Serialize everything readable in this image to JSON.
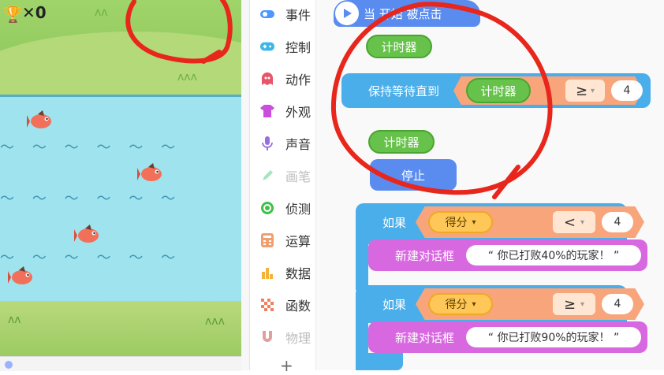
{
  "stage": {
    "score_symbol": "✕",
    "score_value": "0",
    "trophy_icon": "trophy-icon"
  },
  "sidebar": {
    "categories": [
      {
        "label": "事件",
        "icon": "event-toggle-icon",
        "color": "#4c97ff",
        "enabled": true
      },
      {
        "label": "控制",
        "icon": "gamepad-icon",
        "color": "#3cb8e8",
        "enabled": true
      },
      {
        "label": "动作",
        "icon": "ghost-icon",
        "color": "#e8546a",
        "enabled": true
      },
      {
        "label": "外观",
        "icon": "shirt-icon",
        "color": "#c94fdc",
        "enabled": true
      },
      {
        "label": "声音",
        "icon": "microphone-icon",
        "color": "#9a6ee0",
        "enabled": true
      },
      {
        "label": "画笔",
        "icon": "pen-icon",
        "color": "#a8e4c0",
        "enabled": false
      },
      {
        "label": "侦测",
        "icon": "target-icon",
        "color": "#3fc04a",
        "enabled": true
      },
      {
        "label": "运算",
        "icon": "calculator-icon",
        "color": "#f0a070",
        "enabled": true
      },
      {
        "label": "数据",
        "icon": "bar-chart-icon",
        "color": "#f4b23c",
        "enabled": true
      },
      {
        "label": "函数",
        "icon": "checker-flag-icon",
        "color": "#f08060",
        "enabled": true
      },
      {
        "label": "物理",
        "icon": "magnet-icon",
        "color": "#e0a0a0",
        "enabled": false
      }
    ],
    "add_label": "+"
  },
  "workspace": {
    "hat": {
      "label": "当 开始 被点击"
    },
    "timer_pill_1": "计时器",
    "wait_block": {
      "label": "保持等待直到",
      "var": "计时器",
      "op": "≥",
      "value": "4"
    },
    "timer_pill_2": "计时器",
    "stop_block": {
      "label": "停止"
    },
    "if_1": {
      "label": "如果",
      "var": "得分",
      "op": "<",
      "value": "4",
      "action_label": "新建对话框",
      "dialog_text": "“ 你已打败40%的玩家！ ”"
    },
    "if_2": {
      "label": "如果",
      "var": "得分",
      "op": "≥",
      "value": "4",
      "action_label": "新建对话框",
      "dialog_text": "“ 你已打败90%的玩家！ ”"
    }
  },
  "colors": {
    "event_blue": "#5a8cf0",
    "control_blue": "#4aaeea",
    "operator_orange": "#f8a57c",
    "sensing_green": "#66c24a",
    "data_orange": "#ffc757",
    "look_purple": "#d868e0",
    "annotation_red": "#e8261c"
  }
}
